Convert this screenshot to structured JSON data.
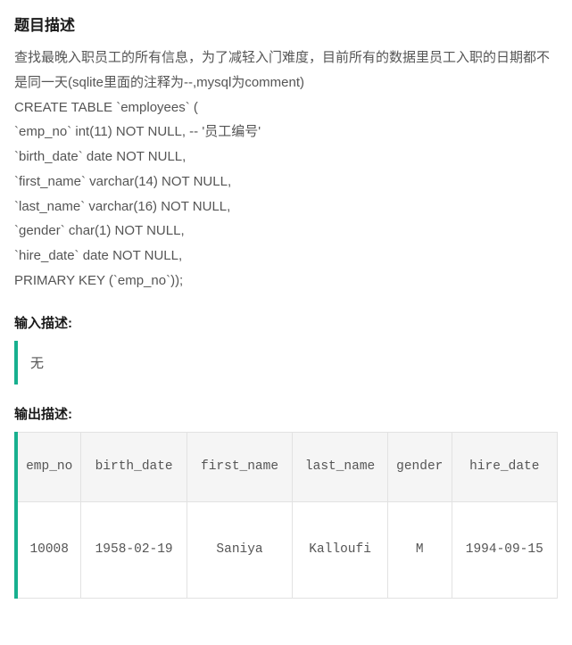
{
  "headers": {
    "problem": "题目描述",
    "input": "输入描述:",
    "output": "输出描述:"
  },
  "problem": {
    "intro": "查找最晚入职员工的所有信息，为了减轻入门难度，目前所有的数据里员工入职的日期都不是同一天(sqlite里面的注释为--,mysql为comment)",
    "ddl": [
      "CREATE TABLE `employees` (",
      "`emp_no` int(11) NOT NULL,  -- '员工编号'",
      "`birth_date` date NOT NULL,",
      "`first_name` varchar(14) NOT NULL,",
      "`last_name` varchar(16) NOT NULL,",
      "`gender` char(1) NOT NULL,",
      "`hire_date` date NOT NULL,",
      "PRIMARY KEY (`emp_no`));"
    ]
  },
  "input_block": "无",
  "output_table": {
    "columns": [
      "emp_no",
      "birth_date",
      "first_name",
      "last_name",
      "gender",
      "hire_date"
    ],
    "rows": [
      [
        "10008",
        "1958-02-19",
        "Saniya",
        "Kalloufi",
        "M",
        "1994-09-15"
      ]
    ]
  }
}
